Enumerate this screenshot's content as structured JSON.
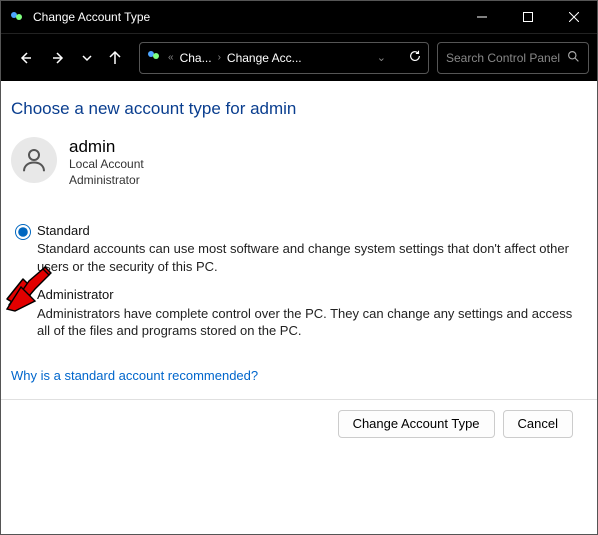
{
  "window": {
    "title": "Change Account Type"
  },
  "nav": {
    "crumb1": "Cha...",
    "crumb2": "Change Acc...",
    "search_placeholder": "Search Control Panel"
  },
  "page": {
    "heading": "Choose a new account type for admin"
  },
  "user": {
    "name": "admin",
    "line1": "Local Account",
    "line2": "Administrator"
  },
  "options": {
    "standard": {
      "label": "Standard",
      "desc": "Standard accounts can use most software and change system settings that don't affect other users or the security of this PC.",
      "checked": true
    },
    "admin": {
      "label": "Administrator",
      "desc": "Administrators have complete control over the PC. They can change any settings and access all of the files and programs stored on the PC.",
      "checked": false
    }
  },
  "link": {
    "recommended": "Why is a standard account recommended?"
  },
  "buttons": {
    "submit": "Change Account Type",
    "cancel": "Cancel"
  }
}
